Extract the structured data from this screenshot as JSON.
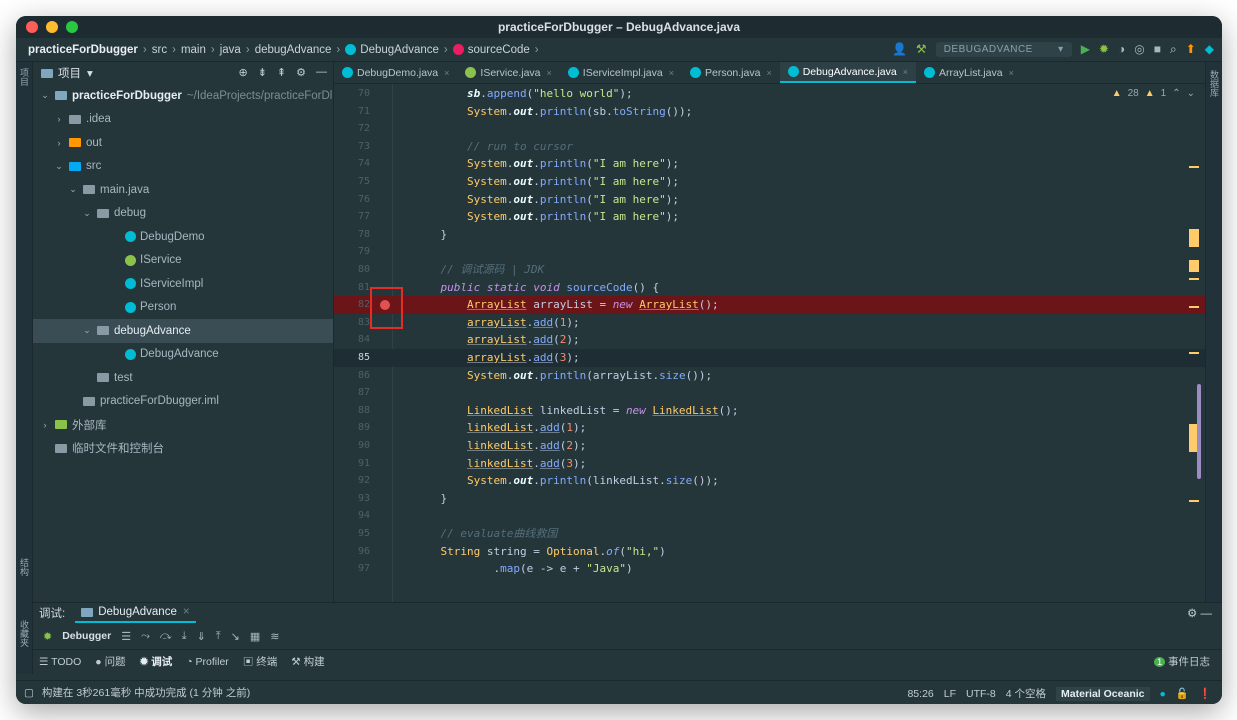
{
  "window": {
    "title": "practiceForDbugger – DebugAdvance.java"
  },
  "breadcrumb": [
    "practiceForDbugger",
    "src",
    "main",
    "java",
    "debugAdvance",
    "DebugAdvance",
    "sourceCode"
  ],
  "toolbar": {
    "run_config": "DEBUGADVANCE"
  },
  "left_strip": {
    "project": "项目",
    "structure": "结构",
    "favorites": "收藏夹"
  },
  "right_strip": {
    "database": "数据库"
  },
  "project_panel": {
    "header": "项目",
    "tree": [
      {
        "label": "practiceForDbugger",
        "suffix": "~/IdeaProjects/practiceForDl",
        "depth": 0,
        "arrow": "⌄",
        "kind": "module"
      },
      {
        "label": ".idea",
        "depth": 1,
        "arrow": "›",
        "kind": "folder"
      },
      {
        "label": "out",
        "depth": 1,
        "arrow": "›",
        "kind": "folder-orange"
      },
      {
        "label": "src",
        "depth": 1,
        "arrow": "⌄",
        "kind": "folder-blue"
      },
      {
        "label": "main.java",
        "depth": 2,
        "arrow": "⌄",
        "kind": "package"
      },
      {
        "label": "debug",
        "depth": 3,
        "arrow": "⌄",
        "kind": "package"
      },
      {
        "label": "DebugDemo",
        "depth": 5,
        "kind": "class-main"
      },
      {
        "label": "IService",
        "depth": 5,
        "kind": "interface"
      },
      {
        "label": "IServiceImpl",
        "depth": 5,
        "kind": "class"
      },
      {
        "label": "Person",
        "depth": 5,
        "kind": "class"
      },
      {
        "label": "debugAdvance",
        "depth": 3,
        "arrow": "⌄",
        "kind": "package",
        "selected": true
      },
      {
        "label": "DebugAdvance",
        "depth": 5,
        "kind": "class-main"
      },
      {
        "label": "test",
        "depth": 3,
        "kind": "package"
      },
      {
        "label": "practiceForDbugger.iml",
        "depth": 2,
        "kind": "iml"
      },
      {
        "label": "外部库",
        "depth": 0,
        "arrow": "›",
        "kind": "lib"
      },
      {
        "label": "临时文件和控制台",
        "depth": 0,
        "kind": "scratch"
      }
    ]
  },
  "editor_tabs": [
    {
      "label": "DebugDemo.java",
      "color": "#00bcd4"
    },
    {
      "label": "IService.java",
      "color": "#8bc34a"
    },
    {
      "label": "IServiceImpl.java",
      "color": "#00bcd4"
    },
    {
      "label": "Person.java",
      "color": "#00bcd4"
    },
    {
      "label": "DebugAdvance.java",
      "color": "#00bcd4",
      "active": true
    },
    {
      "label": "ArrayList.java",
      "color": "#00bcd4"
    }
  ],
  "inspections": {
    "warnings": "28",
    "weak_warnings": "1"
  },
  "code": [
    {
      "n": "70",
      "html": "        <span class=\"fld\">sb</span>.<span class=\"fn\">append</span>(<span class=\"str\">\"hello world\"</span>);"
    },
    {
      "n": "71",
      "html": "        <span class=\"ty\">System</span>.<span class=\"fld\">out</span>.<span class=\"fn\">println</span>(sb.<span class=\"fn\">toString</span>());"
    },
    {
      "n": "72",
      "html": ""
    },
    {
      "n": "73",
      "html": "        <span class=\"cm\">// run to cursor</span>"
    },
    {
      "n": "74",
      "html": "        <span class=\"ty\">System</span>.<span class=\"fld\">out</span>.<span class=\"fn\">println</span>(<span class=\"str\">\"I am here\"</span>);"
    },
    {
      "n": "75",
      "html": "        <span class=\"ty\">System</span>.<span class=\"fld\">out</span>.<span class=\"fn\">println</span>(<span class=\"str\">\"I am here\"</span>);"
    },
    {
      "n": "76",
      "html": "        <span class=\"ty\">System</span>.<span class=\"fld\">out</span>.<span class=\"fn\">println</span>(<span class=\"str\">\"I am here\"</span>);"
    },
    {
      "n": "77",
      "html": "        <span class=\"ty\">System</span>.<span class=\"fld\">out</span>.<span class=\"fn\">println</span>(<span class=\"str\">\"I am here\"</span>);"
    },
    {
      "n": "78",
      "html": "    }"
    },
    {
      "n": "79",
      "html": ""
    },
    {
      "n": "80",
      "html": "    <span class=\"cm\">// 调试源码 | JDK</span>"
    },
    {
      "n": "81",
      "html": "    <span class=\"k\">public static void</span> <span class=\"fn\">sourceCode</span>() {"
    },
    {
      "n": "82",
      "html": "        <span class=\"ty u\">ArrayList</span> arrayList = <span class=\"k\">new</span> <span class=\"ty u\">ArrayList</span>();",
      "breakpoint": true
    },
    {
      "n": "83",
      "html": "        <span class=\"ty u\">arrayList</span>.<span class=\"fn u\">add</span>(<span class=\"num\">1</span>);"
    },
    {
      "n": "84",
      "html": "        <span class=\"ty u\">arrayList</span>.<span class=\"fn u\">add</span>(<span class=\"num\">2</span>);"
    },
    {
      "n": "85",
      "html": "        <span class=\"ty u\">arrayList</span>.<span class=\"fn u\">add</span>(<span class=\"num\">3</span>);",
      "current": true
    },
    {
      "n": "86",
      "html": "        <span class=\"ty\">System</span>.<span class=\"fld\">out</span>.<span class=\"fn\">println</span>(arrayList.<span class=\"fn\">size</span>());"
    },
    {
      "n": "87",
      "html": ""
    },
    {
      "n": "88",
      "html": "        <span class=\"ty u\">LinkedList</span> linkedList = <span class=\"k\">new</span> <span class=\"ty u\">LinkedList</span>();"
    },
    {
      "n": "89",
      "html": "        <span class=\"ty u\">linkedList</span>.<span class=\"fn u\">add</span>(<span class=\"num\">1</span>);"
    },
    {
      "n": "90",
      "html": "        <span class=\"ty u\">linkedList</span>.<span class=\"fn u\">add</span>(<span class=\"num\">2</span>);"
    },
    {
      "n": "91",
      "html": "        <span class=\"ty u\">linkedList</span>.<span class=\"fn u\">add</span>(<span class=\"num\">3</span>);"
    },
    {
      "n": "92",
      "html": "        <span class=\"ty\">System</span>.<span class=\"fld\">out</span>.<span class=\"fn\">println</span>(linkedList.<span class=\"fn\">size</span>());"
    },
    {
      "n": "93",
      "html": "    }"
    },
    {
      "n": "94",
      "html": ""
    },
    {
      "n": "95",
      "html": "    <span class=\"cm\">// evaluate曲线救国</span>"
    },
    {
      "n": "96",
      "html": "    <span class=\"ty\">String</span> string = <span class=\"ty\">Optional</span>.<span class=\"fn\" style=\"font-style:italic\">of</span>(<span class=\"str\">\"hi,\"</span>)"
    },
    {
      "n": "97",
      "html": "            .<span class=\"fn\">map</span>(e -> e + <span class=\"str\">\"Java\"</span>)"
    }
  ],
  "debug_panel": {
    "label": "调试:",
    "tab": "DebugAdvance",
    "debugger": "Debugger",
    "bottom_tools": [
      "TODO",
      "问题",
      "调试",
      "Profiler",
      "终端",
      "构建"
    ],
    "event_log": "事件日志",
    "event_count": "1"
  },
  "status": {
    "message": "构建在 3秒261毫秒 中成功完成 (1 分钟 之前)",
    "position": "85:26",
    "line_sep": "LF",
    "encoding": "UTF-8",
    "indent": "4 个空格",
    "theme": "Material Oceanic"
  }
}
